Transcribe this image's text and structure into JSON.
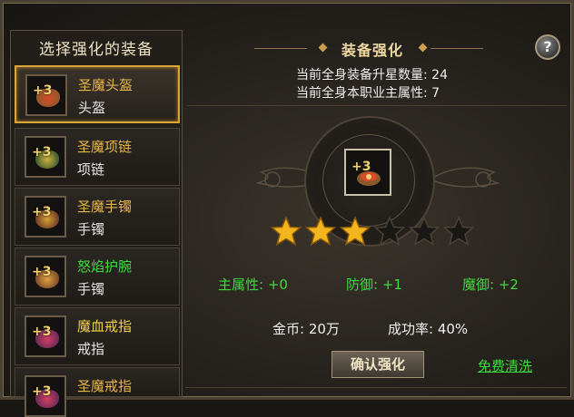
{
  "left_panel": {
    "title": "选择强化的装备",
    "items": [
      {
        "name": "圣魔头盔",
        "type": "头盔",
        "plus": "+3",
        "selected": true,
        "name_color": "orange",
        "icon": "helmet-icon"
      },
      {
        "name": "圣魔项链",
        "type": "项链",
        "plus": "+3",
        "selected": false,
        "name_color": "orange",
        "icon": "necklace-icon"
      },
      {
        "name": "圣魔手镯",
        "type": "手镯",
        "plus": "+3",
        "selected": false,
        "name_color": "orange",
        "icon": "bracelet-icon"
      },
      {
        "name": "怒焰护腕",
        "type": "手镯",
        "plus": "+3",
        "selected": false,
        "name_color": "green",
        "icon": "wristguard-icon"
      },
      {
        "name": "魔血戒指",
        "type": "戒指",
        "plus": "+3",
        "selected": false,
        "name_color": "yellow",
        "icon": "ring-icon"
      },
      {
        "name": "圣魔戒指",
        "type": "",
        "plus": "+3",
        "selected": false,
        "name_color": "orange",
        "icon": "ring-icon"
      }
    ]
  },
  "panel": {
    "title": "装备强化",
    "help_label": "?",
    "stat_star_count": "当前全身装备升星数量: 24",
    "stat_main_attr": "当前全身本职业主属性: 7"
  },
  "enhance": {
    "selected_plus": "+3",
    "stars_total": 6,
    "stars_filled": 3,
    "attrs": {
      "main": "主属性: +0",
      "defense": "防御: +1",
      "magic_defense": "魔御: +2"
    },
    "gold": "金币: 20万",
    "success_rate": "成功率: 40%",
    "confirm_label": "确认强化",
    "free_reset_label": "免费清洗"
  },
  "colors": {
    "gold_accent": "#d9a43a",
    "item_orange": "#e8b64a",
    "item_green": "#3ddc3d",
    "item_yellow": "#f1d24a",
    "attr_green": "#3ddc3d",
    "star_gold": "#f2b51d"
  }
}
